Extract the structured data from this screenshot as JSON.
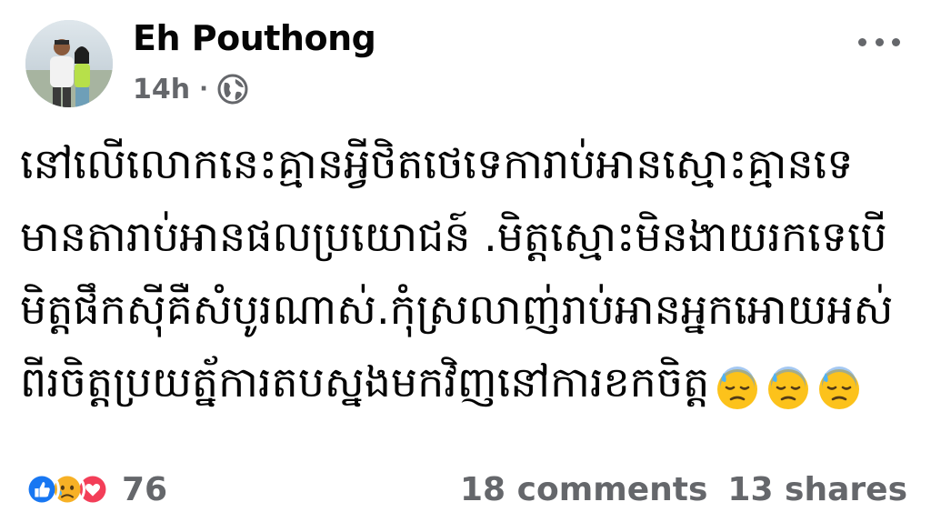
{
  "post": {
    "author": {
      "name": "Eh Pouthong",
      "avatar_icon": "profile-photo"
    },
    "timestamp": "14h",
    "separator": "·",
    "privacy_icon": "globe-icon",
    "more_icon": "more-options-icon",
    "text_lines": [
      "នៅលើលោកនេះគ្មានអ្វីថិតថេទេការាប់អានស្មោះគ្មានទេ",
      "មានតារាប់អានផលប្រយោជន៍ .មិត្តស្មោះមិនងាយរកទេបើ",
      "មិត្តផឹកស៊ីគឺសំបូរណាស់.កុំស្រលាញ់រាប់អានអ្នកអោយអស់",
      "ពីរចិត្តប្រយត្ន័ការតបស្នងមកវិញនៅការខកចិត្ត"
    ],
    "emojis": [
      "downcast-face-with-sweat",
      "downcast-face-with-sweat",
      "downcast-face-with-sweat"
    ],
    "reactions": {
      "icons": [
        "like-icon",
        "sad-icon",
        "love-icon"
      ],
      "count": "76"
    },
    "comments": "18 comments",
    "shares": "13 shares",
    "colors": {
      "secondary_text": "#65676b",
      "like_blue": "#1877f2",
      "love_red": "#f33e58",
      "sad_yellow": "#f7b125"
    }
  }
}
